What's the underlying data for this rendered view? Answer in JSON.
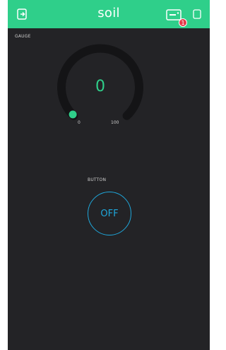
{
  "header": {
    "title": "soil",
    "notification_count": "1",
    "icons": [
      "exit-icon",
      "device-icon",
      "square-icon"
    ],
    "color": "#2fcf8a"
  },
  "gauge": {
    "label": "GAUGE",
    "value": "0",
    "min": "0",
    "max": "100",
    "level": 0,
    "color": "#2fcf8a"
  },
  "button": {
    "label": "BUTTON",
    "state_label": "OFF",
    "color": "#1fa7db"
  }
}
